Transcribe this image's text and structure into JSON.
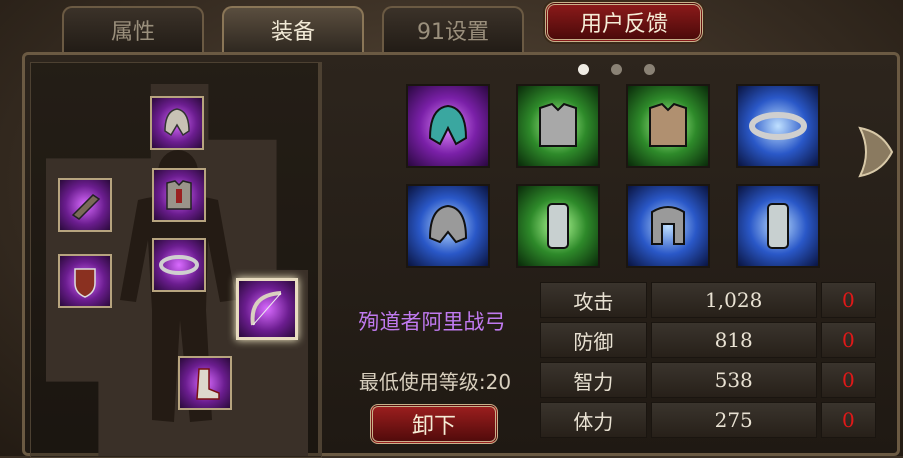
{
  "tabs": [
    {
      "label": "属性",
      "active": false
    },
    {
      "label": "装备",
      "active": true
    },
    {
      "label": "91设置",
      "active": false
    }
  ],
  "feedback_button": "用户反馈",
  "pagination": {
    "pages": 3,
    "current": 1
  },
  "equipped_slots": [
    {
      "icon": "helmet-icon",
      "selected": false
    },
    {
      "icon": "bracer-icon",
      "selected": false
    },
    {
      "icon": "armor-icon",
      "selected": false
    },
    {
      "icon": "shield-icon",
      "selected": false
    },
    {
      "icon": "belt-icon",
      "selected": false
    },
    {
      "icon": "bow-icon",
      "selected": true
    },
    {
      "icon": "boots-icon",
      "selected": false
    }
  ],
  "inventory": [
    {
      "icon": "helmet-icon",
      "rarity": "purple"
    },
    {
      "icon": "armor-icon",
      "rarity": "green"
    },
    {
      "icon": "armor-icon",
      "rarity": "green"
    },
    {
      "icon": "belt-icon",
      "rarity": "blue"
    },
    {
      "icon": "helmet-icon",
      "rarity": "blue"
    },
    {
      "icon": "bracer-icon",
      "rarity": "green"
    },
    {
      "icon": "helmet-icon",
      "rarity": "blue"
    },
    {
      "icon": "bracer-icon",
      "rarity": "blue"
    }
  ],
  "selected_item": {
    "name": "殉道者阿里战弓",
    "level_requirement": "最低使用等级:20",
    "unequip_label": "卸下"
  },
  "stats": [
    {
      "label": "攻击",
      "value": "1,028",
      "bonus": "0"
    },
    {
      "label": "防御",
      "value": "818",
      "bonus": "0"
    },
    {
      "label": "智力",
      "value": "538",
      "bonus": "0"
    },
    {
      "label": "体力",
      "value": "275",
      "bonus": "0"
    }
  ],
  "colors": {
    "item_name": "#c07af0",
    "bonus": "#e01818",
    "purple": "#7a20a8",
    "green": "#2e8a2a",
    "blue": "#2a58c8"
  }
}
